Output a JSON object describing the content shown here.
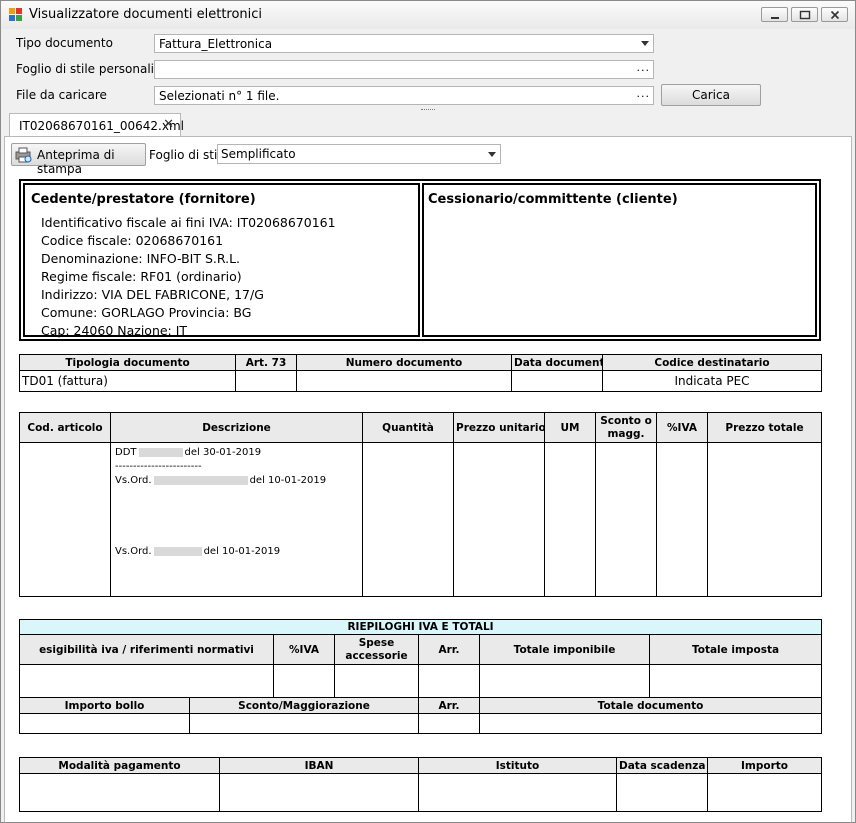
{
  "window": {
    "title": "Visualizzatore documenti elettronici"
  },
  "icons": {
    "app": "app-icon",
    "minimize": "minimize-icon",
    "maximize": "maximize-icon",
    "close": "close-icon",
    "print_preview": "print-preview-icon"
  },
  "form": {
    "tipo_documento": {
      "label": "Tipo documento",
      "value": "Fattura_Elettronica"
    },
    "foglio_stile": {
      "label": "Foglio di stile personalizzato",
      "value": ""
    },
    "file": {
      "label": "File da caricare",
      "value": "Selezionati n° 1 file."
    },
    "ellipsis": "...",
    "load_button": "Carica"
  },
  "tab": {
    "label": "IT02068670161_00642.xml",
    "close": "✕"
  },
  "toolbar": {
    "preview_button": "Anteprima di stampa",
    "stylesheet_label": "Foglio di stile",
    "stylesheet_value": "Semplificato"
  },
  "cedente": {
    "title": "Cedente/prestatore (fornitore)",
    "lines": [
      "Identificativo fiscale ai fini IVA: IT02068670161",
      "Codice fiscale: 02068670161",
      "Denominazione: INFO-BIT S.R.L.",
      "Regime fiscale: RF01 (ordinario)",
      "Indirizzo: VIA DEL FABRICONE, 17/G",
      "Comune: GORLAGO Provincia: BG",
      "Cap: 24060 Nazione: IT"
    ]
  },
  "cessionario": {
    "title": "Cessionario/committente (cliente)"
  },
  "documento": {
    "headers": [
      "Tipologia documento",
      "Art. 73",
      "Numero documento",
      "Data documento",
      "Codice destinatario"
    ],
    "row": [
      "TD01 (fattura)",
      "",
      "",
      "",
      "Indicata PEC"
    ]
  },
  "righe": {
    "headers": [
      "Cod. articolo",
      "Descrizione",
      "Quantità",
      "Prezzo unitario",
      "UM",
      "Sconto o magg.",
      "%IVA",
      "Prezzo totale"
    ],
    "desc": {
      "l1_pre": "DDT",
      "l1_post": "del 30-01-2019",
      "separator": "------------------------",
      "l2_pre": "Vs.Ord.",
      "l2_post": "del 10-01-2019",
      "l3_pre": "Vs.Ord.",
      "l3_post": "del 10-01-2019"
    }
  },
  "riepilogo": {
    "title": "RIEPILOGHI IVA E TOTALI",
    "headers1": [
      "esigibilità iva / riferimenti normativi",
      "%IVA",
      "Spese accessorie",
      "Arr.",
      "Totale imponibile",
      "Totale imposta"
    ],
    "headers2": [
      "Importo bollo",
      "Sconto/Maggiorazione",
      "Arr.",
      "Totale documento"
    ]
  },
  "pagamento": {
    "headers": [
      "Modalità pagamento",
      "IBAN",
      "Istituto",
      "Data scadenza",
      "Importo"
    ]
  }
}
